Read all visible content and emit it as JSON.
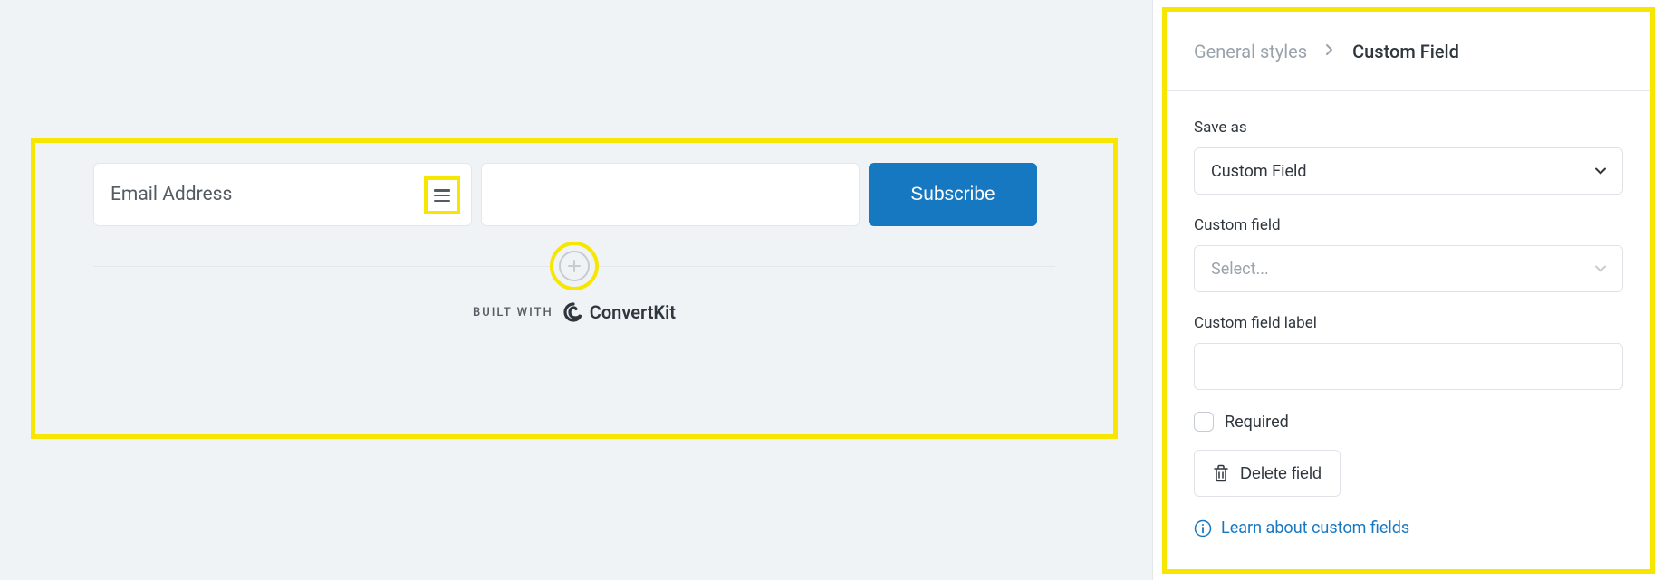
{
  "form": {
    "email_placeholder": "Email Address",
    "second_field_value": "",
    "subscribe_label": "Subscribe",
    "built_with_label": "BUILT WITH",
    "brand": "ConvertKit"
  },
  "panel": {
    "breadcrumb_prev": "General styles",
    "breadcrumb_current": "Custom Field",
    "save_as_label": "Save as",
    "save_as_value": "Custom Field",
    "custom_field_label": "Custom field",
    "custom_field_placeholder": "Select...",
    "field_label_label": "Custom field label",
    "field_label_value": "",
    "required_label": "Required",
    "delete_label": "Delete field",
    "learn_link": "Learn about custom fields"
  }
}
